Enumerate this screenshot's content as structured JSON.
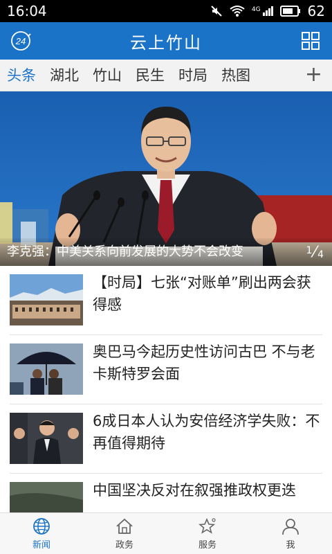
{
  "status": {
    "time": "16:04",
    "network": "4G",
    "battery": "62"
  },
  "app": {
    "title": "云上竹山",
    "badge": "24"
  },
  "tabs": [
    {
      "label": "头条"
    },
    {
      "label": "湖北"
    },
    {
      "label": "竹山"
    },
    {
      "label": "民生"
    },
    {
      "label": "时局"
    },
    {
      "label": "热图"
    }
  ],
  "tabs_add": "+",
  "hero": {
    "caption": "李克强：中美关系向前发展的大势不会改变",
    "page_current": "1",
    "page_total": "4"
  },
  "news": [
    {
      "title": "【时局】七张“对账单”刷出两会获得感"
    },
    {
      "title": "奥巴马今起历史性访问古巴 不与老卡斯特罗会面"
    },
    {
      "title": "6成日本人认为安倍经济学失败：不再值得期待"
    },
    {
      "title": "中国坚决反对在叙强推政权更迭"
    }
  ],
  "nav": [
    {
      "label": "新闻"
    },
    {
      "label": "政务"
    },
    {
      "label": "服务"
    },
    {
      "label": "我"
    }
  ],
  "colors": {
    "accent": "#1b73c8"
  }
}
